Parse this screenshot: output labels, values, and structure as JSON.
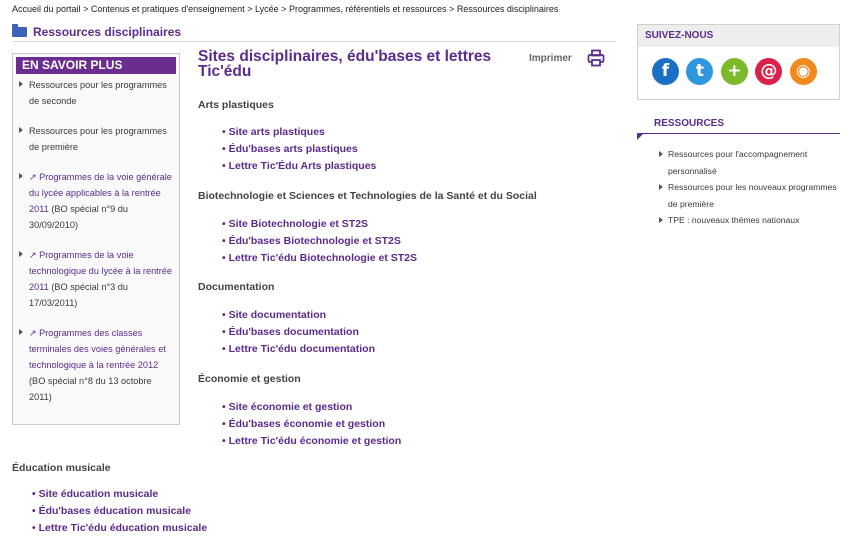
{
  "breadcrumb": {
    "items": [
      "Accueil du portail",
      "Contenus et pratiques d'enseignement",
      "Lycée",
      "Programmes, référentiels et ressources",
      "Ressources disciplinaires"
    ],
    "separator": ">"
  },
  "section": {
    "title": "Ressources disciplinaires",
    "icon": "folder-icon"
  },
  "sidebar": {
    "header": "EN SAVOIR PLUS",
    "items": [
      {
        "label": "Ressources pour les programmes de seconde"
      },
      {
        "label": "Ressources pour les programmes de première"
      },
      {
        "label": "Programmes de la voie générale du lycée applicables à la rentrée 2011",
        "note": "(BO spécial n°9 du 30/09/2010)",
        "icon": "external-link-icon"
      },
      {
        "label": "Programmes de la voie technologique du lycée à la rentrée 2011",
        "note": "(BO spécial n°3 du 17/03/2011)",
        "icon": "external-link-icon"
      },
      {
        "label": "Programmes des classes terminales des voies générales et technologique à la rentrée 2012",
        "note": "(BO spécial n°8 du 13 octobre 2011)",
        "icon": "external-link-icon"
      }
    ]
  },
  "main": {
    "title": "Sites disciplinaires, édu'bases et lettres Tic'édu",
    "print_label": "Imprimer",
    "categories": [
      {
        "name": "Arts plastiques",
        "links": [
          "Site arts plastiques",
          "Édu'bases arts plastiques",
          "Lettre Tic'Édu Arts plastiques"
        ]
      },
      {
        "name": "Biotechnologie et Sciences et Technologies de la Santé et du Social",
        "links": [
          "Site Biotechnologie et ST2S",
          "Édu'bases Biotechnologie et ST2S",
          "Lettre Tic'édu Biotechnologie et ST2S"
        ]
      },
      {
        "name": "Documentation",
        "links": [
          "Site documentation",
          "Édu'bases documentation",
          "Lettre Tic'édu documentation"
        ]
      },
      {
        "name": "Économie et gestion",
        "links": [
          "Site économie et gestion",
          "Édu'bases économie et gestion",
          "Lettre Tic'édu économie et gestion"
        ]
      },
      {
        "name": "Éducation musicale",
        "links": [
          "Site éducation musicale",
          "Édu'bases éducation musicale",
          "Lettre Tic'édu éducation musicale"
        ]
      }
    ]
  },
  "follow": {
    "header": "SUIVEZ-NOUS",
    "icons": [
      {
        "name": "facebook-icon",
        "glyph": "f",
        "color": "#1a6fc4"
      },
      {
        "name": "twitter-icon",
        "glyph": "t",
        "color": "#2e97e0"
      },
      {
        "name": "plus-icon",
        "glyph": "+",
        "color": "#7cba2c"
      },
      {
        "name": "email-icon",
        "glyph": "@",
        "color": "#d8224c"
      },
      {
        "name": "rss-icon",
        "glyph": "◉",
        "color": "#f08a1d"
      }
    ]
  },
  "resources": {
    "header": "RESSOURCES",
    "items": [
      "Ressources pour l'accompagnement personnalisé",
      "Ressources pour les nouveaux programmes de première",
      "TPE : nouveaux thèmes nationaux"
    ]
  },
  "colors": {
    "brand": "#5b2b8e",
    "sidebar_header": "#6b2d8f",
    "folder": "#3d63b8"
  }
}
